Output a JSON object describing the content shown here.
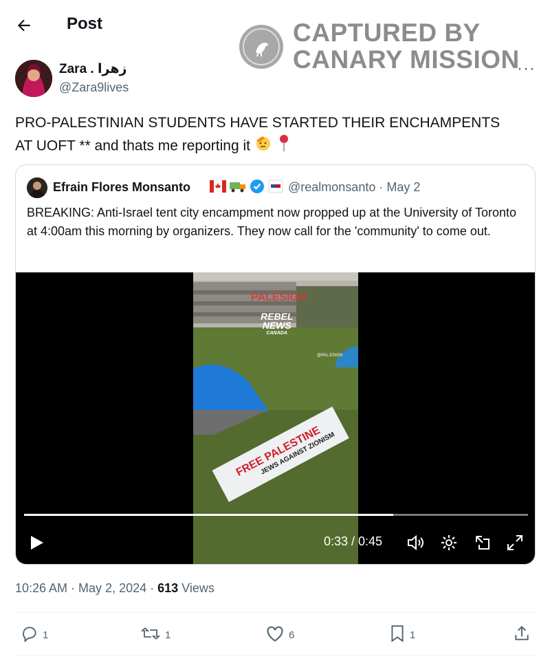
{
  "header": {
    "title": "Post"
  },
  "watermark": {
    "line1": "CAPTURED BY",
    "line2": "CANARY MISSION"
  },
  "author": {
    "name": "Zara . زهرا",
    "handle": "@Zara9lives"
  },
  "post": {
    "line1": "PRO-PALESTINIAN STUDENTS HAVE STARTED THEIR ENCHAMPENTS",
    "line2": "AT UOFT ** and thats me reporting it"
  },
  "quote": {
    "name": "Efrain Flores Monsanto",
    "handle": "@realmonsanto · May 2",
    "text": "BREAKING: Anti-Israel tent city encampment now propped up at the University of Toronto at 4:00am this morning by organizers. They now call for the 'community' to come out.",
    "video": {
      "time": "0:33 / 0:45",
      "progress": 0.733,
      "overlay_sign": "PALESIGN",
      "overlay_brand1": "REBEL",
      "overlay_brand2": "NEWS",
      "overlay_brand3": "CANADA",
      "overlay_tag": "@PAL.ESIGN",
      "banner_text1": "FREE PALESTINE",
      "banner_text2": "JEWS AGAINST ZIONISM"
    }
  },
  "meta": {
    "time": "10:26 AM · May 2, 2024 · ",
    "views_count": "613",
    "views_label": " Views"
  },
  "actions": {
    "replies": "1",
    "reposts": "1",
    "likes": "6",
    "bookmarks": "1"
  },
  "colors": {
    "secondary": "#536471",
    "text": "#0f1419",
    "verified": "#1d9bf0"
  }
}
